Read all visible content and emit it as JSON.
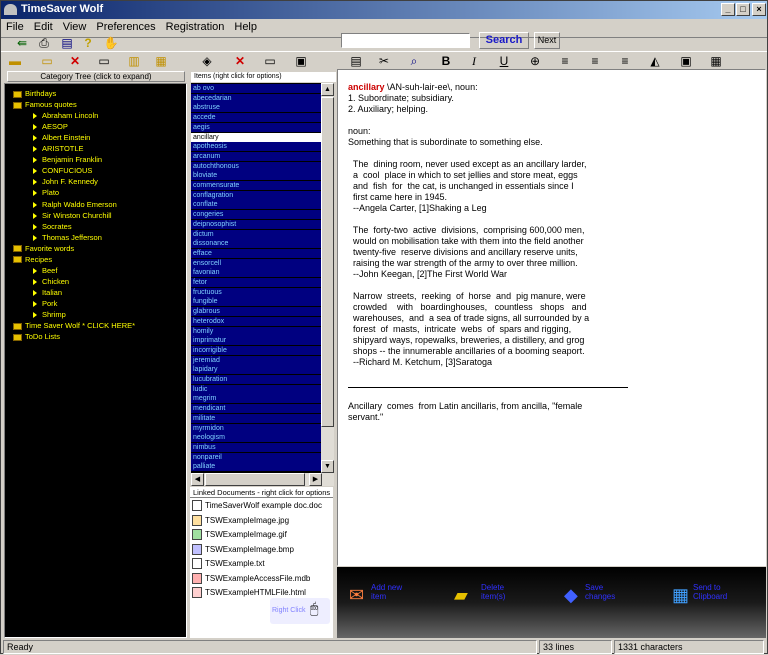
{
  "window": {
    "title": "TimeSaver Wolf"
  },
  "menu": [
    "File",
    "Edit",
    "View",
    "Preferences",
    "Registration",
    "Help"
  ],
  "search": {
    "value": "",
    "button_label": "Search",
    "next_label": "Next"
  },
  "tree": {
    "header": "Category Tree (click to expand)",
    "nodes": [
      {
        "label": "Birthdays",
        "level": 0,
        "icon": "folder-icon"
      },
      {
        "label": "Famous quotes",
        "level": 0,
        "icon": "folder-icon"
      },
      {
        "label": "Abraham Lincoln",
        "level": 1,
        "icon": "arrow-icon"
      },
      {
        "label": "AESOP",
        "level": 1,
        "icon": "arrow-icon"
      },
      {
        "label": "Albert Einstein",
        "level": 1,
        "icon": "arrow-icon"
      },
      {
        "label": "ARISTOTLE",
        "level": 1,
        "icon": "arrow-icon"
      },
      {
        "label": "Benjamin Franklin",
        "level": 1,
        "icon": "arrow-icon"
      },
      {
        "label": "CONFUCIOUS",
        "level": 1,
        "icon": "arrow-icon"
      },
      {
        "label": "John F. Kennedy",
        "level": 1,
        "icon": "arrow-icon"
      },
      {
        "label": "Plato",
        "level": 1,
        "icon": "arrow-icon"
      },
      {
        "label": "Ralph Waldo Emerson",
        "level": 1,
        "icon": "arrow-icon"
      },
      {
        "label": "Sir Winston Churchill",
        "level": 1,
        "icon": "arrow-icon"
      },
      {
        "label": "Socrates",
        "level": 1,
        "icon": "arrow-icon"
      },
      {
        "label": "Thomas Jefferson",
        "level": 1,
        "icon": "arrow-icon"
      },
      {
        "label": "Favorite words",
        "level": 0,
        "icon": "folder-icon"
      },
      {
        "label": "Recipes",
        "level": 0,
        "icon": "folder-icon"
      },
      {
        "label": "Beef",
        "level": 1,
        "icon": "arrow-icon"
      },
      {
        "label": "Chicken",
        "level": 1,
        "icon": "arrow-icon"
      },
      {
        "label": "Italian",
        "level": 1,
        "icon": "arrow-icon"
      },
      {
        "label": "Pork",
        "level": 1,
        "icon": "arrow-icon"
      },
      {
        "label": "Shrimp",
        "level": 1,
        "icon": "arrow-icon"
      },
      {
        "label": "Time Saver Wolf   * CLICK HERE*",
        "level": 0,
        "icon": "folder-icon"
      },
      {
        "label": "ToDo Lists",
        "level": 0,
        "icon": "folder-icon"
      }
    ]
  },
  "items": {
    "header": "Items (right click for options)",
    "selected": "ancillary",
    "list": [
      "ab ovo",
      "abecedarian",
      "abstruse",
      "accede",
      "aegis",
      "ancillary",
      "apotheosis",
      "arcanum",
      "autochthonous",
      "bloviate",
      "commensurate",
      "conflagration",
      "conflate",
      "congeries",
      "deipnosophist",
      "dictum",
      "dissonance",
      "efface",
      "ensorcell",
      "favonian",
      "fetor",
      "fructuous",
      "fungible",
      "glabrous",
      "heterodox",
      "homily",
      "imprimatur",
      "incorrigible",
      "jeremiad",
      "lapidary",
      "lucubration",
      "ludic",
      "megrim",
      "mendicant",
      "militate",
      "myrmidon",
      "neologism",
      "nimbus",
      "nonpareil",
      "palliate"
    ]
  },
  "linked_docs": {
    "header": "Linked Documents - right click for options",
    "list": [
      "TimeSaverWolf example doc.doc",
      "TSWExampleImage.jpg",
      "TSWExampleImage.gif",
      "TSWExampleImage.bmp",
      "TSWExample.txt",
      "TSWExampleAccessFile.mdb",
      "TSWExampleHTMLFile.html"
    ],
    "right_click_hint": "Right Click"
  },
  "content": {
    "headword": "ancillary",
    "pronunciation": " \\AN-suh-lair-ee\\, noun:",
    "body": "\n1. Subordinate; subsidiary.\n2. Auxiliary; helping.\n\nnoun:\nSomething that is subordinate to something else.\n\n  The  dining room, never used except as an ancillary larder,\n  a  cool  place in which to set jellies and store meat, eggs\n  and  fish  for  the cat, is unchanged in essentials since I\n  first came here in 1945.\n  --Angela Carter, [1]Shaking a Leg\n\n  The  forty-two  active  divisions,  comprising 600,000 men,\n  would on mobilisation take with them into the field another\n  twenty-five  reserve divisions and ancillary reserve units,\n  raising the war strength of the army to over three million.\n  --John Keegan, [2]The First World War\n\n  Narrow  streets,  reeking  of  horse  and  pig manure, were\n  crowded    with   boardinghouses,   countless   shops   and\n  warehouses,  and  a sea of trade signs, all surrounded by a\n  forest  of  masts,  intricate  webs  of  spars and rigging,\n  shipyard ways, ropewalks, breweries, a distillery, and grog\n  shops -- the innumerable ancillaries of a booming seaport.\n  --Richard M. Ketchum, [3]Saratoga",
    "footer": "Ancillary  comes  from Latin ancillaris, from ancilla, \"female\nservant.\""
  },
  "actions": [
    {
      "label": "Add new\nitem",
      "icon": "add-item-icon"
    },
    {
      "label": "Delete\nitem(s)",
      "icon": "delete-folder-icon"
    },
    {
      "label": "Save\nchanges",
      "icon": "save-icon"
    },
    {
      "label": "Send to\nClipboard",
      "icon": "clipboard-icon"
    }
  ],
  "status": {
    "ready": "Ready",
    "lines": "33 lines",
    "chars": "1331 characters"
  },
  "colors": {
    "title_start": "#0a246a",
    "tree_text": "#ffff00",
    "item_bg": "#000080",
    "item_text": "#7fd0ff",
    "headword": "#cc0000",
    "action_text": "#3030ff"
  }
}
